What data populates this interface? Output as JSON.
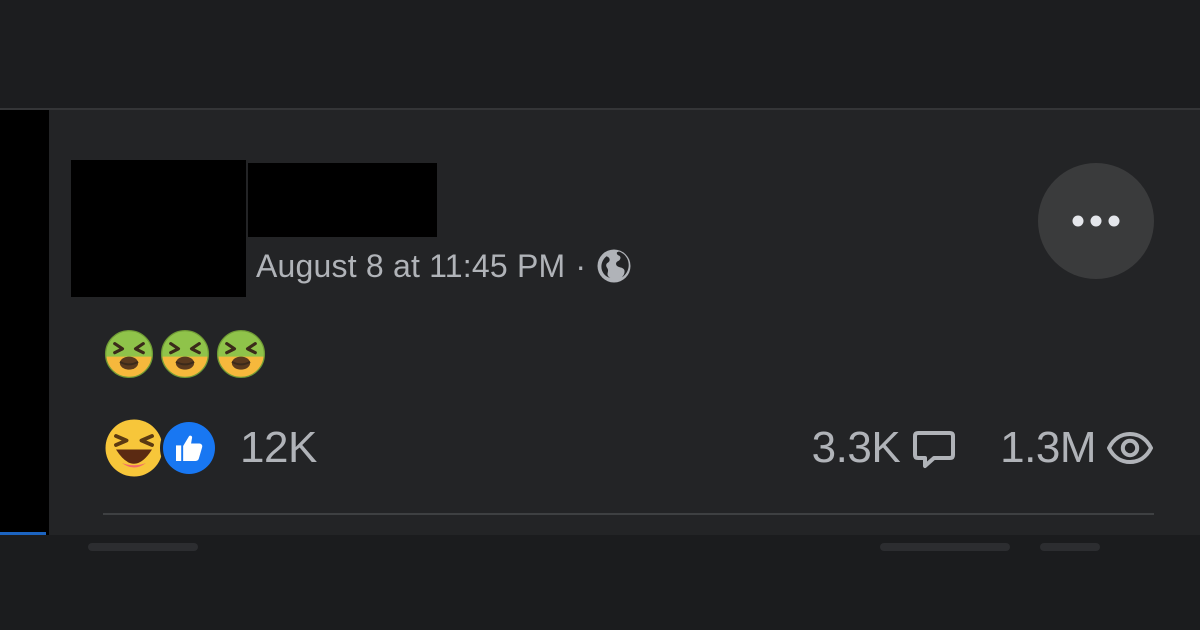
{
  "post": {
    "timestamp": "August 8 at 11:45 PM",
    "separator": "·",
    "audience_icon": "globe-icon",
    "more_icon": "ellipsis-icon",
    "body_emojis": [
      "nauseated-face-icon",
      "nauseated-face-icon",
      "nauseated-face-icon"
    ],
    "reactions": {
      "icons": [
        "haha-reaction-icon",
        "like-reaction-icon"
      ],
      "count": "12K"
    },
    "comments": {
      "count": "3.3K",
      "icon": "comment-bubble-icon"
    },
    "views": {
      "count": "1.3M",
      "icon": "eye-icon"
    }
  },
  "colors": {
    "background": "#1e1f21",
    "card": "#232426",
    "secondary_text": "#b0b3b8",
    "more_button": "#3a3b3c",
    "like_blue": "#1877f2",
    "redaction": "#000000"
  }
}
